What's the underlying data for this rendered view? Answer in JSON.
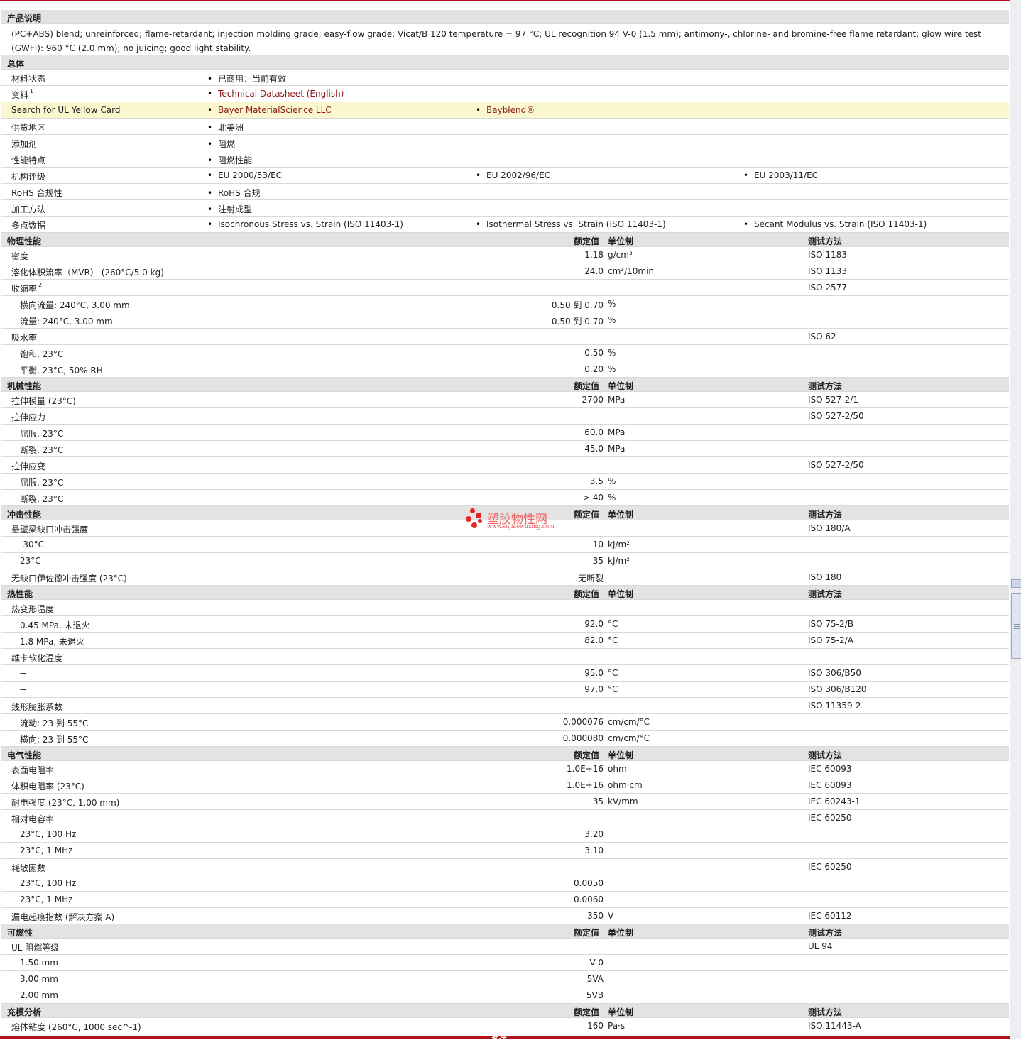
{
  "description": {
    "title": "产品说明",
    "text": "(PC+ABS) blend; unreinforced; flame-retardant; injection molding grade; easy-flow grade; Vicat/B 120 temperature = 97 °C; UL recognition 94 V-0 (1.5 mm); antimony-, chlorine- and bromine-free flame retardant; glow wire test (GWFI): 960 °C (2.0 mm); no juicing; good light stability."
  },
  "general": {
    "title": "总体",
    "rows": [
      {
        "label": "材料状态",
        "items": [
          "已商用：当前有效"
        ]
      },
      {
        "label": "资料",
        "sup": "1",
        "items": [
          "Technical Datasheet (English)"
        ],
        "link": true
      },
      {
        "label": "Search for UL Yellow Card",
        "items": [
          "Bayer MaterialScience LLC",
          "Bayblend®"
        ],
        "link": true,
        "highlight": true
      },
      {
        "label": "供货地区",
        "items": [
          "北美洲"
        ]
      },
      {
        "label": "添加剂",
        "items": [
          "阻燃"
        ]
      },
      {
        "label": "性能特点",
        "items": [
          "阻燃性能"
        ]
      },
      {
        "label": "机构评级",
        "items": [
          "EU 2000/53/EC",
          "EU 2002/96/EC",
          "EU 2003/11/EC"
        ]
      },
      {
        "label": "RoHS 合规性",
        "items": [
          "RoHS 合规"
        ]
      },
      {
        "label": "加工方法",
        "items": [
          "注射成型"
        ]
      },
      {
        "label": "多点数据",
        "items": [
          "Isochronous Stress vs. Strain (ISO 11403-1)",
          "Isothermal Stress vs. Strain (ISO 11403-1)",
          "Secant Modulus vs. Strain (ISO 11403-1)"
        ]
      }
    ]
  },
  "headers": {
    "value": "额定值",
    "unit": "单位制",
    "method": "测试方法"
  },
  "sections": [
    {
      "title": "物理性能",
      "rows": [
        {
          "label": "密度",
          "value": "1.18",
          "unit": "g/cm³",
          "method": "ISO 1183"
        },
        {
          "label": "溶化体积流率（MVR） (260°C/5.0 kg)",
          "value": "24.0",
          "unit": "cm³/10min",
          "method": "ISO 1133"
        },
        {
          "label": "收缩率",
          "sup": "2",
          "method": "ISO 2577"
        },
        {
          "label": "横向流量: 240°C, 3.00 mm",
          "indent": true,
          "value": "0.50 到  0.70",
          "unit": "%"
        },
        {
          "label": "流量: 240°C, 3.00 mm",
          "indent": true,
          "value": "0.50 到  0.70",
          "unit": "%"
        },
        {
          "label": "吸水率",
          "method": "ISO 62"
        },
        {
          "label": "饱和, 23°C",
          "indent": true,
          "value": "0.50",
          "unit": "%"
        },
        {
          "label": "平衡, 23°C, 50% RH",
          "indent": true,
          "value": "0.20",
          "unit": "%"
        }
      ]
    },
    {
      "title": "机械性能",
      "rows": [
        {
          "label": "拉伸模量 (23°C)",
          "value": "2700",
          "unit": "MPa",
          "method": "ISO 527-2/1"
        },
        {
          "label": "拉伸应力",
          "method": "ISO 527-2/50"
        },
        {
          "label": "屈服, 23°C",
          "indent": true,
          "value": "60.0",
          "unit": "MPa"
        },
        {
          "label": "断裂, 23°C",
          "indent": true,
          "value": "45.0",
          "unit": "MPa"
        },
        {
          "label": "拉伸应变",
          "method": "ISO 527-2/50"
        },
        {
          "label": "屈服, 23°C",
          "indent": true,
          "value": "3.5",
          "unit": "%"
        },
        {
          "label": "断裂, 23°C",
          "indent": true,
          "value": "> 40",
          "unit": "%"
        }
      ]
    },
    {
      "title": "冲击性能",
      "rows": [
        {
          "label": "悬壁梁缺口冲击强度",
          "method": "ISO 180/A"
        },
        {
          "label": "-30°C",
          "indent": true,
          "value": "10",
          "unit": "kJ/m²"
        },
        {
          "label": "23°C",
          "indent": true,
          "value": "35",
          "unit": "kJ/m²"
        },
        {
          "label": "无缺口伊佐德冲击强度 (23°C)",
          "value": "无断裂",
          "method": "ISO 180"
        }
      ]
    },
    {
      "title": "热性能",
      "rows": [
        {
          "label": "热变形温度"
        },
        {
          "label": "0.45 MPa, 未退火",
          "indent": true,
          "value": "92.0",
          "unit": "°C",
          "method": "ISO 75-2/B"
        },
        {
          "label": "1.8 MPa, 未退火",
          "indent": true,
          "value": "82.0",
          "unit": "°C",
          "method": "ISO 75-2/A"
        },
        {
          "label": "维卡软化温度"
        },
        {
          "label": "--",
          "indent": true,
          "value": "95.0",
          "unit": "°C",
          "method": "ISO 306/B50"
        },
        {
          "label": "--",
          "indent": true,
          "value": "97.0",
          "unit": "°C",
          "method": "ISO 306/B120"
        },
        {
          "label": "线形膨胀系数",
          "method": "ISO 11359-2"
        },
        {
          "label": "流动: 23 到  55°C",
          "indent": true,
          "value": "0.000076",
          "unit": "cm/cm/°C"
        },
        {
          "label": "横向: 23 到  55°C",
          "indent": true,
          "value": "0.000080",
          "unit": "cm/cm/°C"
        }
      ]
    },
    {
      "title": "电气性能",
      "rows": [
        {
          "label": "表面电阻率",
          "value": "1.0E+16",
          "unit": "ohm",
          "method": "IEC 60093"
        },
        {
          "label": "体积电阻率 (23°C)",
          "value": "1.0E+16",
          "unit": "ohm·cm",
          "method": "IEC 60093"
        },
        {
          "label": "耐电强度 (23°C, 1.00 mm)",
          "value": "35",
          "unit": "kV/mm",
          "method": "IEC 60243-1"
        },
        {
          "label": "相对电容率",
          "method": "IEC 60250"
        },
        {
          "label": "23°C, 100 Hz",
          "indent": true,
          "value": "3.20"
        },
        {
          "label": "23°C, 1 MHz",
          "indent": true,
          "value": "3.10"
        },
        {
          "label": "耗散因数",
          "method": "IEC 60250"
        },
        {
          "label": "23°C, 100 Hz",
          "indent": true,
          "value": "0.0050"
        },
        {
          "label": "23°C, 1 MHz",
          "indent": true,
          "value": "0.0060"
        },
        {
          "label": "漏电起痕指数 (解决方案 A)",
          "value": "350",
          "unit": "V",
          "method": "IEC 60112"
        }
      ]
    },
    {
      "title": "可燃性",
      "rows": [
        {
          "label": "UL 阻燃等级",
          "method": "UL 94"
        },
        {
          "label": "1.50 mm",
          "indent": true,
          "value": "V-0"
        },
        {
          "label": "3.00 mm",
          "indent": true,
          "value": "5VA"
        },
        {
          "label": "2.00 mm",
          "indent": true,
          "value": "5VB"
        }
      ]
    },
    {
      "title": "充模分析",
      "rows": [
        {
          "label": "熔体粘度 (260°C, 1000 sec^-1)",
          "value": "160",
          "unit": "Pa·s",
          "method": "ISO 11443-A"
        }
      ]
    }
  ],
  "footer_label": "备注",
  "watermark": {
    "name": "塑胶物性网",
    "url": "www.sujiaowuxing.com"
  },
  "colors": {
    "accent": "#b3121b",
    "header_bg": "#e3e3e3",
    "highlight_bg": "#fbf8cf",
    "link": "#8b1a1a"
  }
}
